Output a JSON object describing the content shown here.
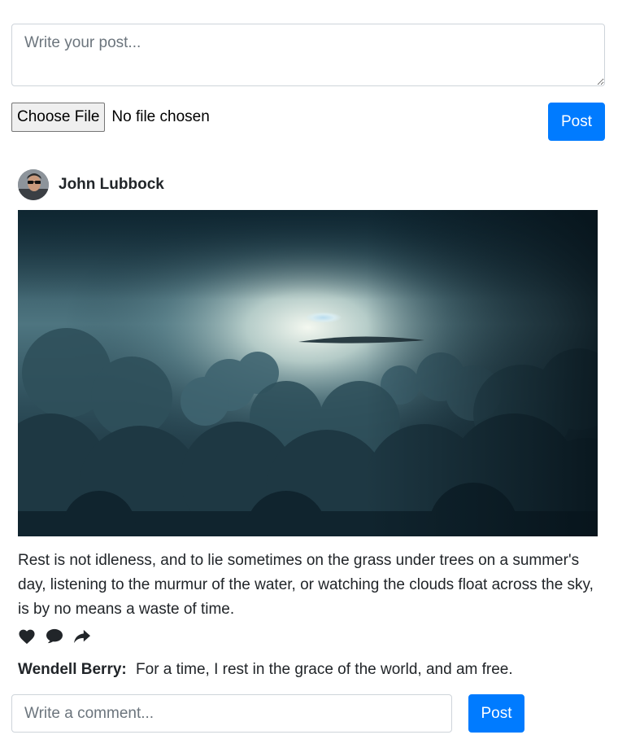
{
  "composer": {
    "placeholder": "Write your post...",
    "file_button_label": "Choose File",
    "file_status": "No file chosen",
    "post_label": "Post"
  },
  "post": {
    "author": "John Lubbock",
    "text": "Rest is not idleness, and to lie sometimes on the grass under trees on a summer's day, listening to the murmur of the water, or watching the clouds float across the sky, is by no means a waste of time.",
    "actions": [
      "heart-icon",
      "comment-icon",
      "share-icon"
    ]
  },
  "comments": [
    {
      "author": "Wendell Berry:",
      "text": "For a time, I rest in the grace of the world, and am free."
    }
  ],
  "comment_form": {
    "placeholder": "Write a comment...",
    "post_label": "Post"
  },
  "colors": {
    "primary": "#007bff",
    "text": "#212529",
    "border": "#ced4da"
  }
}
